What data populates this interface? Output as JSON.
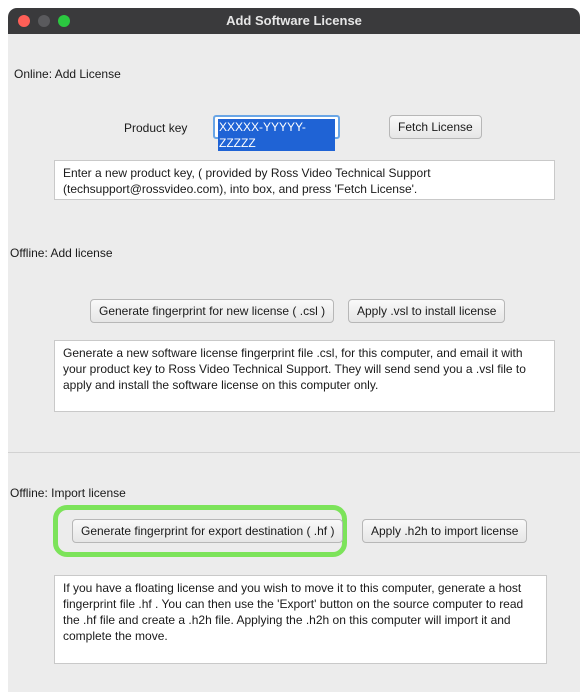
{
  "window": {
    "title": "Add Software License"
  },
  "online": {
    "heading": "Online: Add License",
    "product_key_label": "Product key",
    "product_key_value": "XXXXX-YYYYY-ZZZZZ",
    "fetch_button": "Fetch License",
    "info_line1": "Enter a new product key, ( provided by Ross Video Technical Support",
    "info_line2": "(techsupport@rossvideo.com), into box, and press 'Fetch License'."
  },
  "offline_add": {
    "heading": "Offline: Add license",
    "generate_button": "Generate fingerprint for new license ( .csl )",
    "apply_button": "Apply .vsl to install license",
    "info_line1": "Generate a new software license fingerprint file .csl, for this computer, and email it with",
    "info_line2": "your product key to Ross Video Technical Support. They will send send you a .vsl file to",
    "info_line3": "apply and install the software license on this computer only."
  },
  "offline_import": {
    "heading": "Offline: Import license",
    "generate_button": "Generate fingerprint for export destination ( .hf )",
    "apply_button": "Apply .h2h to import license",
    "info_line1": "If you have a floating license and you wish to move it to this computer, generate a host",
    "info_line2": "fingerprint file .hf . You can then use the 'Export' button on the source computer to read",
    "info_line3": "the .hf file and create a .h2h file. Applying the .h2h on this computer will import it and",
    "info_line4": "complete the move."
  },
  "colors": {
    "highlight": "#7ce35a",
    "selection": "#1f63d5",
    "titlebar": "#3a3a3c"
  }
}
